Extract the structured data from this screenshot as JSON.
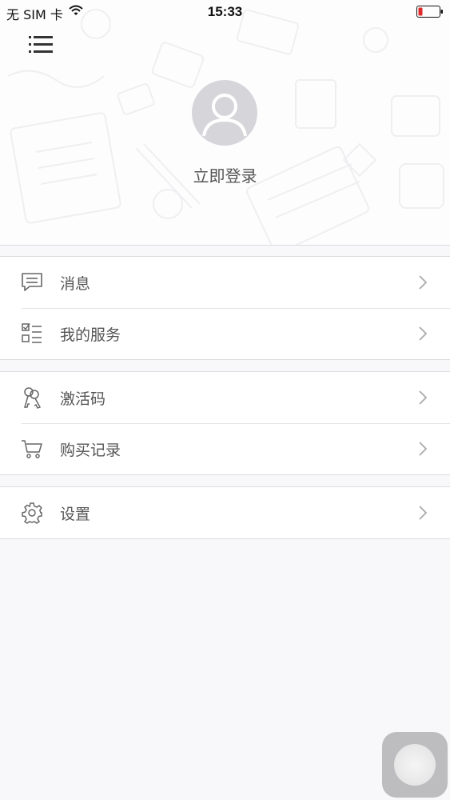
{
  "status_bar": {
    "carrier": "无 SIM 卡",
    "time": "15:33",
    "wifi_icon": "wifi-icon",
    "battery_icon": "battery-low-icon"
  },
  "header": {
    "menu_icon": "list-menu-icon",
    "avatar_icon": "user-avatar-icon",
    "login_label": "立即登录"
  },
  "menu_groups": [
    {
      "items": [
        {
          "label": "消息",
          "icon": "message-icon"
        },
        {
          "label": "我的服务",
          "icon": "checklist-icon"
        }
      ]
    },
    {
      "items": [
        {
          "label": "激活码",
          "icon": "keys-icon"
        },
        {
          "label": "购买记录",
          "icon": "cart-icon"
        }
      ]
    },
    {
      "items": [
        {
          "label": "设置",
          "icon": "gear-icon"
        }
      ]
    }
  ],
  "assistive_touch_icon": "assistive-touch-icon",
  "colors": {
    "background": "#f8f7f9",
    "avatar_gray": "#d6d5da",
    "text": "#555555",
    "divider": "#dcdcdf"
  }
}
